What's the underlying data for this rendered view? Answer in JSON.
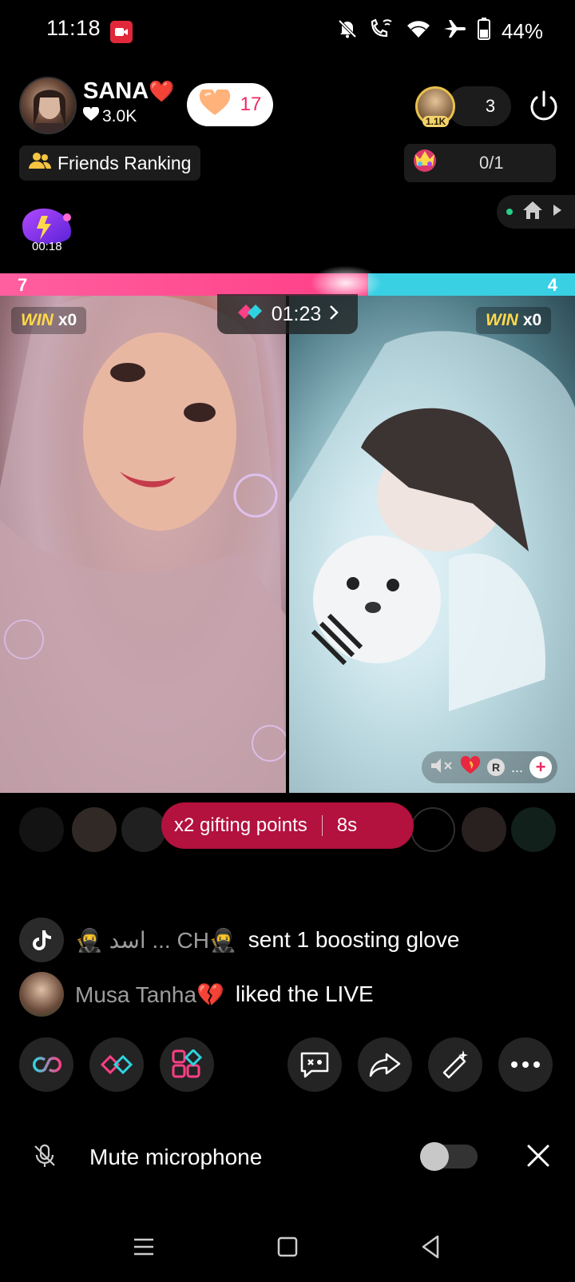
{
  "status_bar": {
    "time": "11:18",
    "battery": "44%",
    "icons": [
      "recording-icon",
      "mute-notifications-icon",
      "wifi-call-icon",
      "wifi-icon",
      "airplane-icon",
      "battery-icon"
    ]
  },
  "host": {
    "name": "SANA",
    "name_emoji": "❤️",
    "likes": "3.0K",
    "gift_count": "17"
  },
  "viewers": {
    "top_level_badge": "1.1K",
    "count": "3"
  },
  "friends_ranking": {
    "label": "Friends Ranking"
  },
  "quest": {
    "progress": "0/1"
  },
  "timer_badge": {
    "time": "00:18"
  },
  "battle": {
    "score_left": "7",
    "score_right": "4",
    "left_share": 0.64,
    "timer": "01:23",
    "win_left_label": "WIN",
    "win_left_count": "x0",
    "win_right_label": "WIN",
    "win_right_count": "x0"
  },
  "right_panel": {
    "overlay_letter": "R",
    "overlay_ellipsis": "..."
  },
  "gifting_banner": {
    "label": "x2 gifting points",
    "countdown": "8s"
  },
  "comments": [
    {
      "user": "🥷 اسد ... CH🥷",
      "message": "sent 1 boosting glove"
    },
    {
      "user": "Musa Tanha💔",
      "message": "liked the LIVE"
    }
  ],
  "mute_row": {
    "label": "Mute microphone",
    "enabled": false
  },
  "colors": {
    "accent_pink": "#ff3f86",
    "accent_cyan": "#3ad0e4",
    "banner_red": "#b3113e",
    "win_yellow": "#ffd84a"
  }
}
